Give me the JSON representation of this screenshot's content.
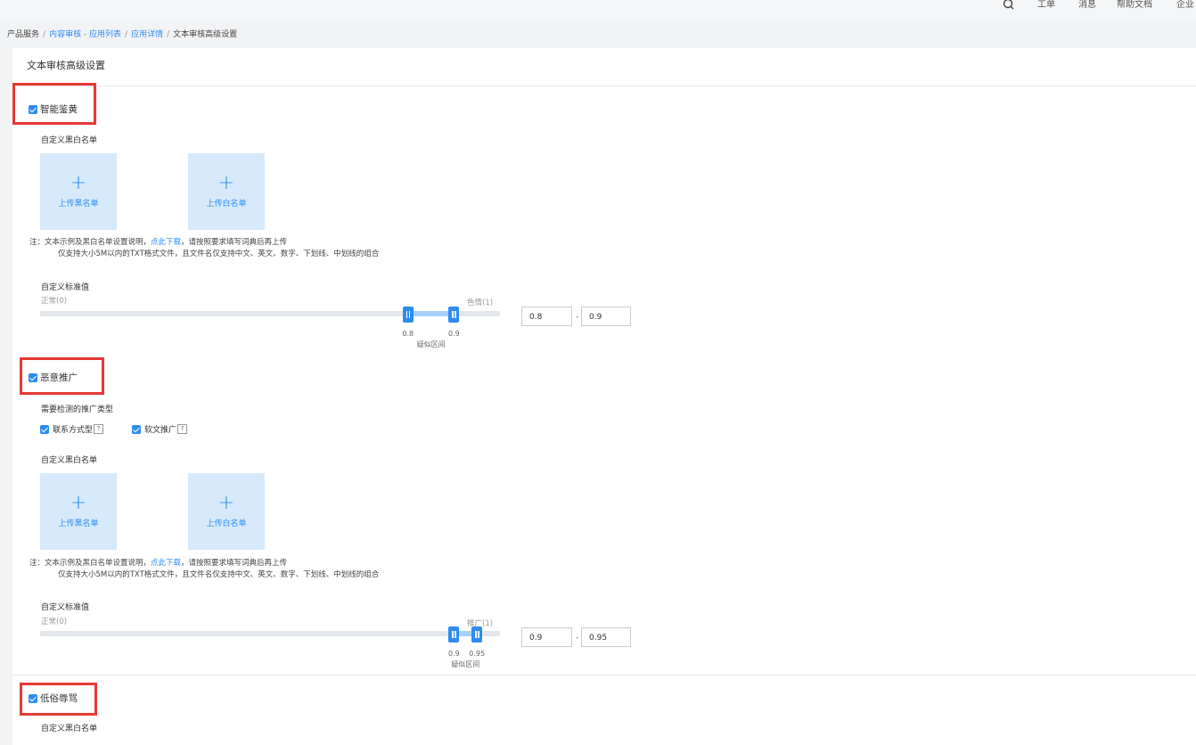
{
  "topbar": {
    "items": [
      "工单",
      "消息",
      "帮助文档",
      "企业"
    ]
  },
  "breadcrumb": {
    "root": "产品服务",
    "link1": "内容审核 - 应用列表",
    "link2": "应用详情",
    "current": "文本审核高级设置",
    "sep": "/"
  },
  "page": {
    "title": "文本审核高级设置"
  },
  "sections": [
    {
      "label": "智能鉴黄",
      "list_title": "自定义黑白名单",
      "upload_black": "上传黑名单",
      "upload_white": "上传白名单",
      "plus": "+",
      "note_prefix": "注：文本示例及黑白名单设置说明，",
      "note_link": "点此下载",
      "note_suffix": "，请按照要求填写词典后再上传",
      "note_line2": "仅支持大小5M以内的TXT格式文件，且文件名仅支持中文、英文、数字、下划线、中划线的组合",
      "threshold_title": "自定义标准值",
      "left_label": "正常(0)",
      "right_label": "色情(1)",
      "low": "0.8",
      "high": "0.9",
      "low_value": 0.8,
      "high_value": 0.9,
      "range_label": "疑似区间",
      "dash": "-"
    },
    {
      "label": "恶意推广",
      "type_title": "需要检测的推广类型",
      "type1": "联系方式型",
      "type2": "软文推广",
      "qmark": "?",
      "list_title": "自定义黑白名单",
      "upload_black": "上传黑名单",
      "upload_white": "上传白名单",
      "plus": "+",
      "note_prefix": "注：文本示例及黑白名单设置说明，",
      "note_link": "点此下载",
      "note_suffix": "，请按照要求填写词典后再上传",
      "note_line2": "仅支持大小5M以内的TXT格式文件，且文件名仅支持中文、英文、数字、下划线、中划线的组合",
      "threshold_title": "自定义标准值",
      "left_label": "正常(0)",
      "right_label": "推广(1)",
      "low": "0.9",
      "high": "0.95",
      "low_value": 0.9,
      "high_value": 0.95,
      "range_label": "疑似区间",
      "dash": "-"
    },
    {
      "label": "低俗辱骂",
      "list_title": "自定义黑白名单"
    }
  ],
  "colors": {
    "accent": "#2d8cf0",
    "highlight_box": "#e53935",
    "upload_bg": "#d6eafc"
  }
}
